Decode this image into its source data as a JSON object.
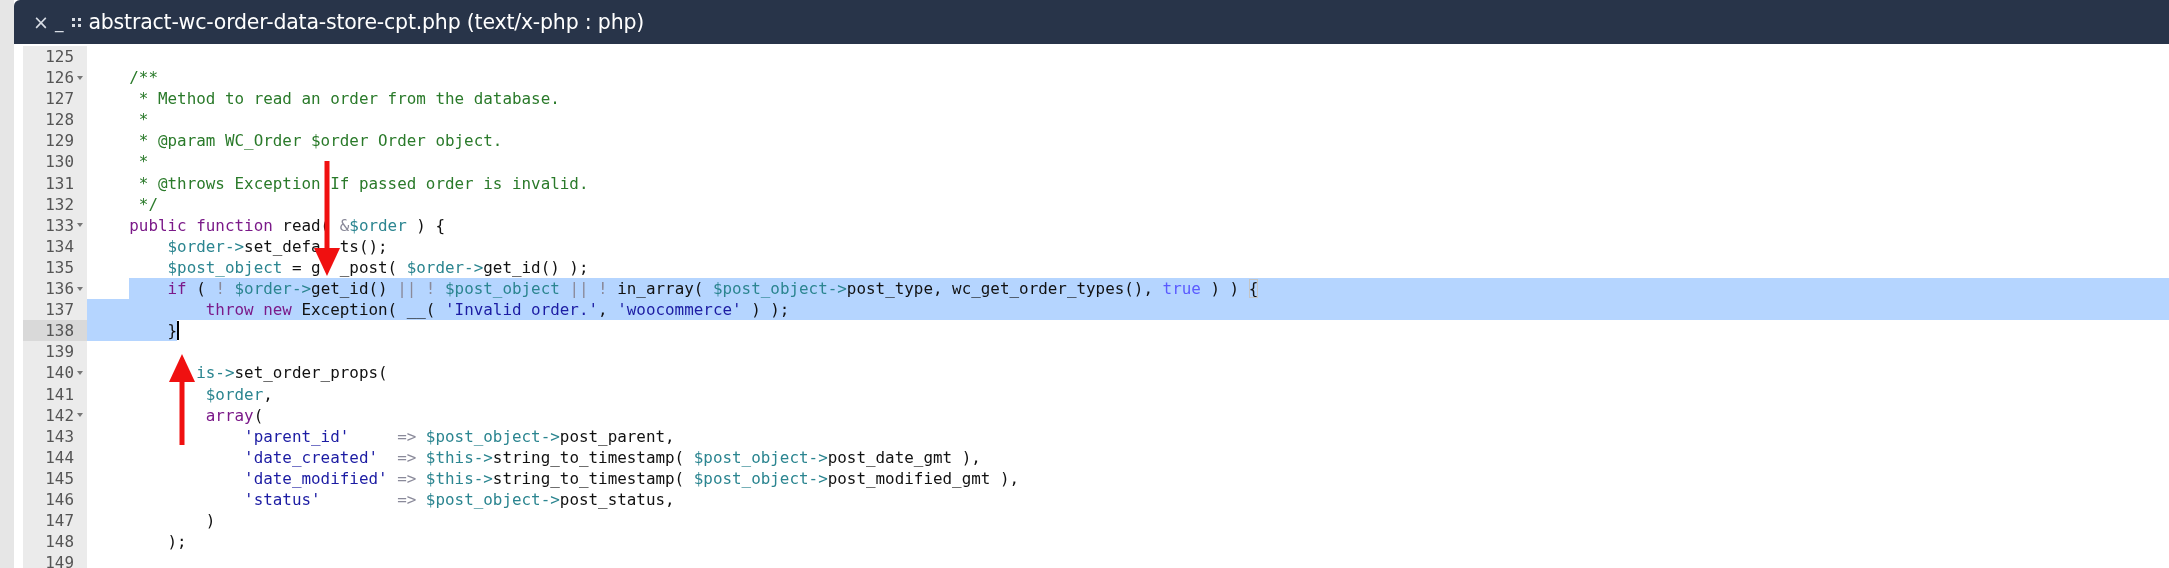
{
  "window": {
    "title": "abstract-wc-order-data-store-cpt.php (text/x-php : php)",
    "close": "×",
    "minimize": "_"
  },
  "editor": {
    "lines": [
      {
        "number": "125",
        "foldable": false,
        "active": false,
        "selected": false,
        "cursor": false
      },
      {
        "number": "126",
        "foldable": true,
        "active": false,
        "selected": false,
        "cursor": false,
        "tokens": [
          {
            "kind": "comment",
            "text": "    /**"
          }
        ]
      },
      {
        "number": "127",
        "foldable": false,
        "active": false,
        "selected": false,
        "cursor": false,
        "tokens": [
          {
            "kind": "comment",
            "text": "     * Method to read an order from the database."
          }
        ]
      },
      {
        "number": "128",
        "foldable": false,
        "active": false,
        "selected": false,
        "cursor": false,
        "tokens": [
          {
            "kind": "comment",
            "text": "     *"
          }
        ]
      },
      {
        "number": "129",
        "foldable": false,
        "active": false,
        "selected": false,
        "cursor": false,
        "tokens": [
          {
            "kind": "comment",
            "text": "     * @param WC_Order $order Order object."
          }
        ]
      },
      {
        "number": "130",
        "foldable": false,
        "active": false,
        "selected": false,
        "cursor": false,
        "tokens": [
          {
            "kind": "comment",
            "text": "     *"
          }
        ]
      },
      {
        "number": "131",
        "foldable": false,
        "active": false,
        "selected": false,
        "cursor": false,
        "tokens": [
          {
            "kind": "comment",
            "text": "     * @throws Exception If passed order is invalid."
          }
        ]
      },
      {
        "number": "132",
        "foldable": false,
        "active": false,
        "selected": false,
        "cursor": false,
        "tokens": [
          {
            "kind": "comment",
            "text": "     */"
          }
        ]
      },
      {
        "number": "133",
        "foldable": true,
        "active": false,
        "selected": false,
        "cursor": false,
        "tokens": [
          {
            "kind": "keyword",
            "text": "    public function"
          },
          {
            "kind": "plain",
            "text": " read( "
          },
          {
            "kind": "operator",
            "text": "&"
          },
          {
            "kind": "variable",
            "text": "$order"
          },
          {
            "kind": "plain",
            "text": " ) {"
          }
        ]
      },
      {
        "number": "134",
        "foldable": false,
        "active": false,
        "selected": false,
        "cursor": false,
        "tokens": [
          {
            "kind": "variable",
            "text": "        $order->"
          },
          {
            "kind": "plain",
            "text": "set_defa  ts();"
          }
        ]
      },
      {
        "number": "135",
        "foldable": false,
        "active": false,
        "selected": false,
        "cursor": false,
        "tokens": [
          {
            "kind": "variable",
            "text": "        $post_object"
          },
          {
            "kind": "plain",
            "text": " = g  _post( "
          },
          {
            "kind": "variable",
            "text": "$order->"
          },
          {
            "kind": "plain",
            "text": "get_id() );"
          }
        ]
      },
      {
        "number": "136",
        "foldable": true,
        "active": false,
        "selected": true,
        "cursor": false,
        "tokens": [
          {
            "kind": "keyword",
            "text": "        if"
          },
          {
            "kind": "plain",
            "text": " ( "
          },
          {
            "kind": "operator",
            "text": "! "
          },
          {
            "kind": "variable",
            "text": "$order->"
          },
          {
            "kind": "plain",
            "text": "get_id() "
          },
          {
            "kind": "operator",
            "text": "|| ! "
          },
          {
            "kind": "variable",
            "text": "$post_object"
          },
          {
            "kind": "operator",
            "text": " || ! "
          },
          {
            "kind": "plain",
            "text": "in_array( "
          },
          {
            "kind": "variable",
            "text": "$post_object->"
          },
          {
            "kind": "plain",
            "text": "post_type, wc_get_order_types(), "
          },
          {
            "kind": "atom",
            "text": "true"
          },
          {
            "kind": "plain",
            "text": " ) ) "
          },
          {
            "kind": "bracket",
            "text": "{"
          }
        ]
      },
      {
        "number": "137",
        "foldable": false,
        "active": false,
        "selected": true,
        "cursor": false,
        "tokens": [
          {
            "kind": "keyword",
            "text": "            throw new"
          },
          {
            "kind": "plain",
            "text": " Exception( __( "
          },
          {
            "kind": "string",
            "text": "'Invalid order.'"
          },
          {
            "kind": "plain",
            "text": ", "
          },
          {
            "kind": "string",
            "text": "'woocommerce'"
          },
          {
            "kind": "plain",
            "text": " ) );"
          }
        ]
      },
      {
        "number": "138",
        "foldable": false,
        "active": true,
        "selected": true,
        "cursor": true,
        "tokens": [
          {
            "kind": "plain",
            "text": "        }"
          }
        ]
      },
      {
        "number": "139",
        "foldable": false,
        "active": false,
        "selected": false,
        "cursor": false
      },
      {
        "number": "140",
        "foldable": true,
        "active": false,
        "selected": false,
        "cursor": false,
        "tokens": [
          {
            "kind": "variable",
            "text": "           is->"
          },
          {
            "kind": "plain",
            "text": "set_order_props("
          }
        ]
      },
      {
        "number": "141",
        "foldable": false,
        "active": false,
        "selected": false,
        "cursor": false,
        "tokens": [
          {
            "kind": "variable",
            "text": "            $order"
          },
          {
            "kind": "plain",
            "text": ","
          }
        ]
      },
      {
        "number": "142",
        "foldable": true,
        "active": false,
        "selected": false,
        "cursor": false,
        "tokens": [
          {
            "kind": "keyword",
            "text": "            array"
          },
          {
            "kind": "plain",
            "text": "("
          }
        ]
      },
      {
        "number": "143",
        "foldable": false,
        "active": false,
        "selected": false,
        "cursor": false,
        "tokens": [
          {
            "kind": "string",
            "text": "                'parent_id'"
          },
          {
            "kind": "operator",
            "text": "     => "
          },
          {
            "kind": "variable",
            "text": "$post_object->"
          },
          {
            "kind": "plain",
            "text": "post_parent,"
          }
        ]
      },
      {
        "number": "144",
        "foldable": false,
        "active": false,
        "selected": false,
        "cursor": false,
        "tokens": [
          {
            "kind": "string",
            "text": "                'date_created'"
          },
          {
            "kind": "operator",
            "text": "  => "
          },
          {
            "kind": "variable",
            "text": "$this->"
          },
          {
            "kind": "plain",
            "text": "string_to_timestamp( "
          },
          {
            "kind": "variable",
            "text": "$post_object->"
          },
          {
            "kind": "plain",
            "text": "post_date_gmt ),"
          }
        ]
      },
      {
        "number": "145",
        "foldable": false,
        "active": false,
        "selected": false,
        "cursor": false,
        "tokens": [
          {
            "kind": "string",
            "text": "                'date_modified'"
          },
          {
            "kind": "operator",
            "text": " => "
          },
          {
            "kind": "variable",
            "text": "$this->"
          },
          {
            "kind": "plain",
            "text": "string_to_timestamp( "
          },
          {
            "kind": "variable",
            "text": "$post_object->"
          },
          {
            "kind": "plain",
            "text": "post_modified_gmt ),"
          }
        ]
      },
      {
        "number": "146",
        "foldable": false,
        "active": false,
        "selected": false,
        "cursor": false,
        "tokens": [
          {
            "kind": "string",
            "text": "                'status'"
          },
          {
            "kind": "operator",
            "text": "        => "
          },
          {
            "kind": "variable",
            "text": "$post_object->"
          },
          {
            "kind": "plain",
            "text": "post_status,"
          }
        ]
      },
      {
        "number": "147",
        "foldable": false,
        "active": false,
        "selected": false,
        "cursor": false,
        "tokens": [
          {
            "kind": "plain",
            "text": "            )"
          }
        ]
      },
      {
        "number": "148",
        "foldable": false,
        "active": false,
        "selected": false,
        "cursor": false,
        "tokens": [
          {
            "kind": "plain",
            "text": "        );"
          }
        ]
      },
      {
        "number": "149",
        "foldable": false,
        "active": false,
        "selected": false,
        "cursor": false
      }
    ]
  },
  "annotations": [
    {
      "kind": "down-arrow"
    },
    {
      "kind": "up-arrow"
    }
  ]
}
